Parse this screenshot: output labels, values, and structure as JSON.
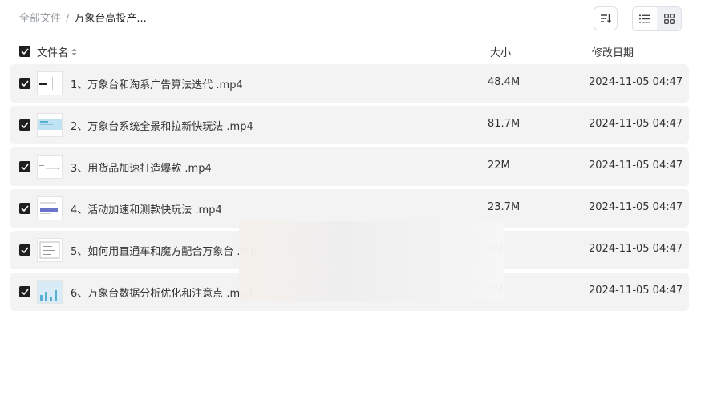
{
  "breadcrumb": {
    "root": "全部文件",
    "separator": "/",
    "current": "万象台高投产..."
  },
  "toolbar": {
    "sort_icon": "sort-icon",
    "list_icon": "list-view-icon",
    "grid_icon": "grid-view-icon"
  },
  "header": {
    "name": "文件名",
    "size": "大小",
    "date": "修改日期"
  },
  "files": [
    {
      "name": "1、万象台和淘系广告算法迭代 .mp4",
      "size": "48.4M",
      "date": "2024-11-05 04:47"
    },
    {
      "name": "2、万象台系统全景和拉新快玩法 .mp4",
      "size": "81.7M",
      "date": "2024-11-05 04:47"
    },
    {
      "name": "3、用货品加速打造爆款 .mp4",
      "size": "22M",
      "date": "2024-11-05 04:47"
    },
    {
      "name": "4、活动加速和测款快玩法 .mp4",
      "size": "23.7M",
      "date": "2024-11-05 04:47"
    },
    {
      "name": "5、如何用直通车和魔方配合万象台 .mp",
      "size": "4M",
      "date": "2024-11-05 04:47"
    },
    {
      "name": "6、万象台数据分析优化和注意点 .mp4",
      "size": "2M",
      "date": "2024-11-05 04:47"
    }
  ],
  "colors": {
    "row_bg": "#f3f3f4",
    "checkbox": "#1f1f1f",
    "muted": "#9aa0a6"
  }
}
